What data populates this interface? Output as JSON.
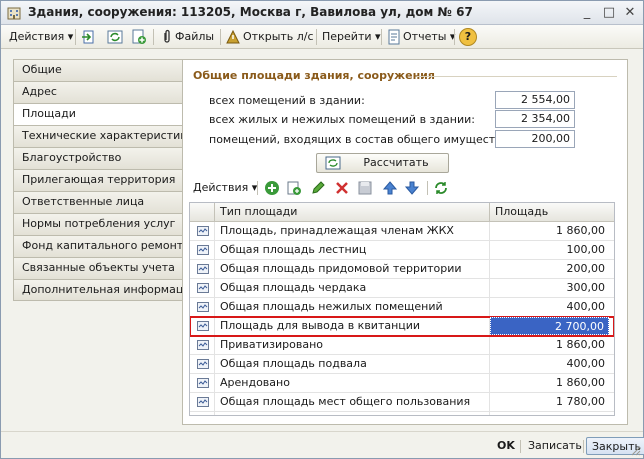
{
  "window": {
    "title": "Здания, сооружения: 113205, Москва г, Вавилова ул, дом № 67",
    "minimize": "_",
    "maximize": "□",
    "close": "✕"
  },
  "toolbar": {
    "actions_label": "Действия",
    "files_label": "Файлы",
    "open_account_label": "Открыть л/с",
    "goto_label": "Перейти",
    "reports_label": "Отчеты",
    "help_label": "?"
  },
  "nav": {
    "items": [
      {
        "label": "Общие"
      },
      {
        "label": "Адрес"
      },
      {
        "label": "Площади"
      },
      {
        "label": "Технические характеристики"
      },
      {
        "label": "Благоустройство"
      },
      {
        "label": "Прилегающая территория"
      },
      {
        "label": "Ответственные лица"
      },
      {
        "label": "Нормы потребления услуг"
      },
      {
        "label": "Фонд капитального ремонта"
      },
      {
        "label": "Связанные объекты учета"
      },
      {
        "label": "Дополнительная информация"
      }
    ],
    "active_index": 2
  },
  "summary": {
    "title": "Общие площади здания, сооружения",
    "fields": [
      {
        "label": "всех помещений в здании:",
        "value": "2 554,00"
      },
      {
        "label": "всех жилых и нежилых помещений в здании:",
        "value": "2 354,00"
      },
      {
        "label": "помещений, входящих в состав общего имущества:",
        "value": "200,00"
      }
    ],
    "calculate_label": "Рассчитать"
  },
  "table": {
    "actions_label": "Действия",
    "columns": [
      "Тип площади",
      "Площадь"
    ],
    "rows": [
      {
        "type": "Площадь, принадлежащая членам ЖКХ",
        "area": "1 860,00"
      },
      {
        "type": "Общая площадь лестниц",
        "area": "100,00"
      },
      {
        "type": "Общая площадь придомовой территории",
        "area": "200,00"
      },
      {
        "type": "Общая площадь чердака",
        "area": "300,00"
      },
      {
        "type": "Общая площадь нежилых помещений",
        "area": "400,00"
      },
      {
        "type": "Площадь для вывода в квитанции",
        "area": "2 700,00"
      },
      {
        "type": "Приватизировано",
        "area": "1 860,00"
      },
      {
        "type": "Общая площадь подвала",
        "area": "400,00"
      },
      {
        "type": "Арендовано",
        "area": "1 860,00"
      },
      {
        "type": "Общая площадь мест общего пользования",
        "area": "1 780,00"
      }
    ],
    "selected_index": 5
  },
  "footer": {
    "ok_label": "OK",
    "save_label": "Записать",
    "close_label": "Закрыть"
  },
  "colors": {
    "section_title": "#8a5a1a",
    "selection": "#3a64c4",
    "highlight_border": "#d81818"
  }
}
